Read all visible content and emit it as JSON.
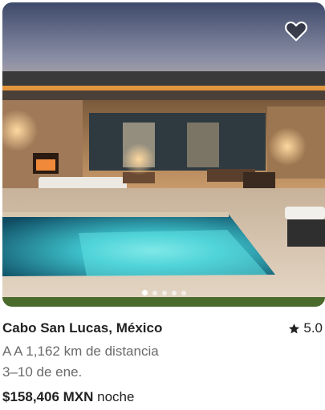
{
  "listing": {
    "title": "Cabo San Lucas, México",
    "rating": "5.0",
    "distance": "A A 1,162 km de distancia",
    "dates": "3–10 de ene.",
    "price": "$158,406 MXN",
    "price_unit": "noche"
  },
  "photo": {
    "carousel_count": 5,
    "active_index": 0
  },
  "icons": {
    "favorite": "heart-icon",
    "rating": "star-icon"
  },
  "colors": {
    "text_primary": "#222222",
    "text_secondary": "#6a6a6a",
    "pool_glow": "#4fd1d9"
  }
}
